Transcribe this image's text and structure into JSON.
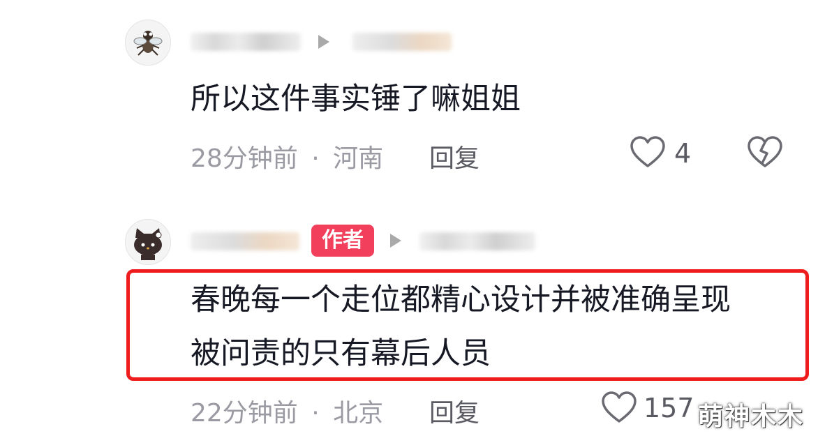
{
  "comments": [
    {
      "avatar": "fly-cartoon-avatar",
      "text": "所以这件事实锤了嘛姐姐",
      "time": "28分钟前",
      "separator": "·",
      "location": "河南",
      "reply_label": "回复",
      "likes": "4"
    },
    {
      "avatar": "hello-kitty-avatar",
      "badge": "作者",
      "text_line1": "春晚每一个走位都精心设计并被准确呈现",
      "text_line2": "被问责的只有幕后人员",
      "time": "22分钟前",
      "separator": "·",
      "location": "北京",
      "reply_label": "回复",
      "likes": "157"
    }
  ],
  "icons": {
    "like": "heart-outline-icon",
    "dislike": "broken-heart-icon",
    "reply_arrow": "play-arrow-icon"
  },
  "colors": {
    "highlight_border": "#ee1c1c",
    "author_badge": "#f23f5c",
    "meta_text": "#9a9aa3"
  },
  "watermark": "萌神木木"
}
